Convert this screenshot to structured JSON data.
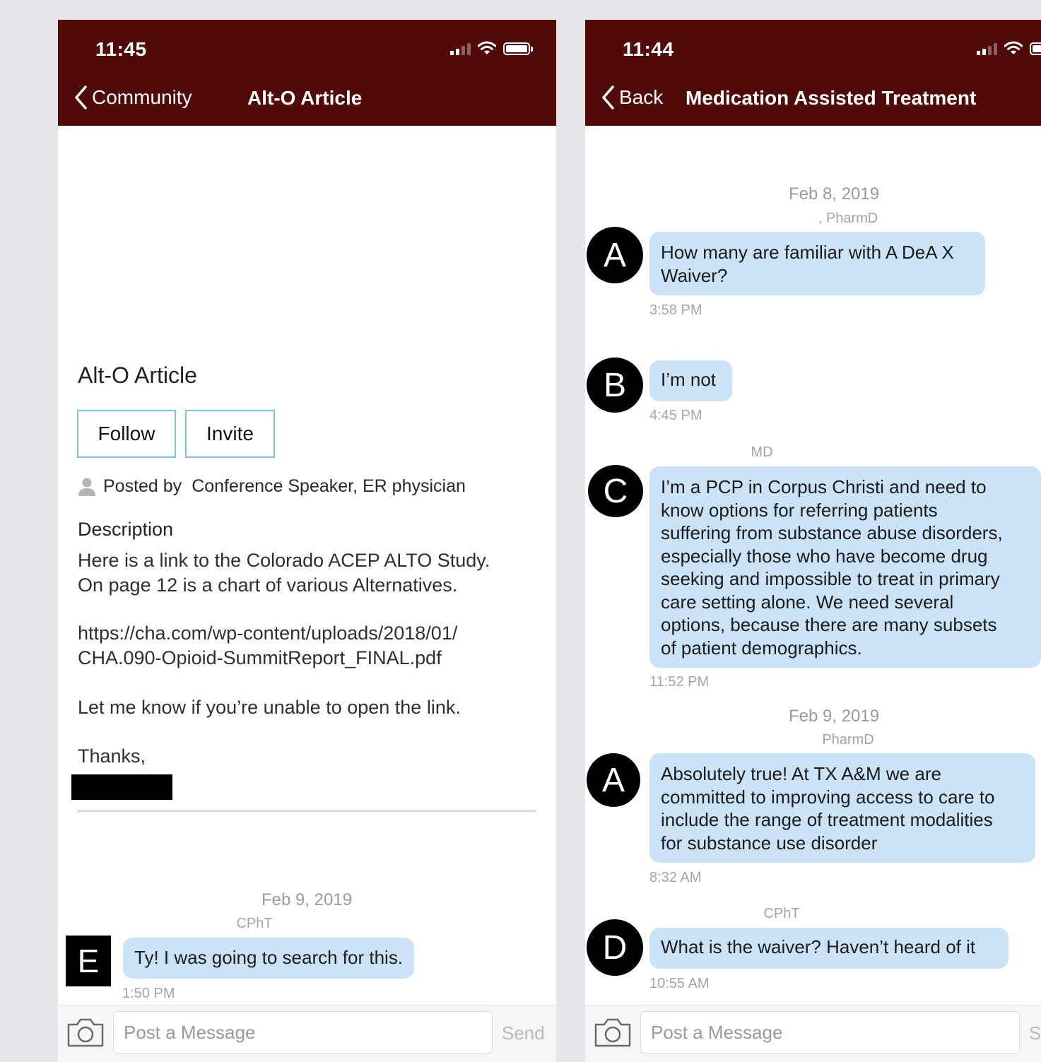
{
  "colors": {
    "header": "#500a08",
    "bubble": "#cbe3f7",
    "outline": "#7fc0ea"
  },
  "left": {
    "status": {
      "time": "11:45"
    },
    "nav": {
      "back_label": "Community",
      "title": "Alt-O Article"
    },
    "article": {
      "title": "Alt-O Article",
      "follow_label": "Follow",
      "invite_label": "Invite",
      "posted_by_label": "Posted by",
      "author": "Conference Speaker, ER physician",
      "description_heading": "Description",
      "lines": [
        "Here is a link to the Colorado ACEP ALTO Study.",
        "On page 12 is a chart of various Alternatives.",
        "https://cha.com/wp-content/uploads/2018/01/",
        "CHA.090-Opioid-SummitReport_FINAL.pdf",
        "Let me know if you’re unable to open the link.",
        "Thanks,"
      ]
    },
    "chat": {
      "date": "Feb 9, 2019",
      "sender": "CPhT",
      "avatar": "E",
      "text": "Ty! I was going to search for this.",
      "time": "1:50 PM"
    },
    "compose": {
      "placeholder": "Post a Message",
      "send_label": "Send"
    }
  },
  "right": {
    "status": {
      "time": "11:44"
    },
    "nav": {
      "back_label": "Back",
      "title": "Medication Assisted Treatment"
    },
    "messages": [
      {
        "date": "Feb 8, 2019",
        "sender": ", PharmD",
        "avatar": "A",
        "lines": [
          "How many are familiar with A DeA X",
          "Waiver?"
        ],
        "time": "3:58 PM"
      },
      {
        "avatar": "B",
        "lines": [
          "I’m not"
        ],
        "time": "4:45 PM"
      },
      {
        "sender": "MD",
        "avatar": "C",
        "lines": [
          "I’m a PCP in Corpus Christi and need to",
          "know options for referring patients",
          "suffering from substance abuse disorders,",
          "especially those who have become drug",
          "seeking and impossible to treat in primary",
          "care setting alone.  We need several",
          "options, because there are many subsets",
          "of patient demographics."
        ],
        "time": "11:52 PM"
      },
      {
        "date": "Feb 9, 2019",
        "sender": "PharmD",
        "avatar": "A",
        "lines": [
          "Absolutely true! At TX A&M we are",
          "committed to improving access to care to",
          "include the range of treatment modalities",
          "for substance use disorder"
        ],
        "time": "8:32 AM"
      },
      {
        "sender": "CPhT",
        "avatar": "D",
        "lines": [
          "What is the waiver? Haven’t heard of it"
        ],
        "time": "10:55 AM"
      }
    ],
    "compose": {
      "placeholder": "Post a Message",
      "send_label": "S"
    }
  }
}
